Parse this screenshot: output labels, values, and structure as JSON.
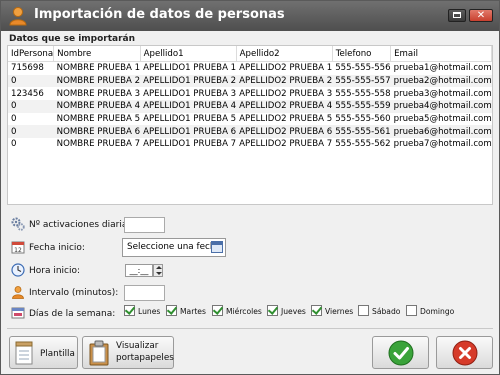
{
  "window": {
    "title": "Importación de datos de personas",
    "close_glyph": "✕"
  },
  "section_title": "Datos que se importarán",
  "grid": {
    "columns": [
      "IdPersona",
      "Nombre",
      "Apellido1",
      "Apellido2",
      "Telefono",
      "Email"
    ],
    "rows": [
      [
        "715698",
        "NOMBRE PRUEBA 1",
        "APELLIDO1 PRUEBA 1",
        "APELLIDO2 PRUEBA 1",
        "555-555-556",
        "prueba1@hotmail.com"
      ],
      [
        "0",
        "NOMBRE PRUEBA 2",
        "APELLIDO1 PRUEBA 2",
        "APELLIDO2 PRUEBA 2",
        "555-555-557",
        "prueba2@hotmail.com"
      ],
      [
        "123456",
        "NOMBRE PRUEBA 3",
        "APELLIDO1 PRUEBA 3",
        "APELLIDO2 PRUEBA 3",
        "555-555-558",
        "prueba3@hotmail.com"
      ],
      [
        "0",
        "NOMBRE PRUEBA 4",
        "APELLIDO1 PRUEBA 4",
        "APELLIDO2 PRUEBA 4",
        "555-555-559",
        "prueba4@hotmail.com"
      ],
      [
        "0",
        "NOMBRE PRUEBA 5",
        "APELLIDO1 PRUEBA 5",
        "APELLIDO2 PRUEBA 5",
        "555-555-560",
        "prueba5@hotmail.com"
      ],
      [
        "0",
        "NOMBRE PRUEBA 6",
        "APELLIDO1 PRUEBA 6",
        "APELLIDO2 PRUEBA 6",
        "555-555-561",
        "prueba6@hotmail.com"
      ],
      [
        "0",
        "NOMBRE PRUEBA 7",
        "APELLIDO1 PRUEBA 7",
        "APELLIDO2 PRUEBA 7",
        "555-555-562",
        "prueba7@hotmail.com"
      ]
    ]
  },
  "form": {
    "activations_label": "Nº activaciones diarias:",
    "activations_value": "",
    "start_date_label": "Fecha inicio:",
    "start_date_button": "Seleccione una fecha",
    "start_time_label": "Hora inicio:",
    "start_time_value": "__:__",
    "interval_label": "Intervalo (minutos):",
    "interval_value": "",
    "weekdays_label": "Días de la semana:",
    "weekdays": [
      {
        "label": "Lunes",
        "checked": true
      },
      {
        "label": "Martes",
        "checked": true
      },
      {
        "label": "Miércoles",
        "checked": true
      },
      {
        "label": "Jueves",
        "checked": true
      },
      {
        "label": "Viernes",
        "checked": true
      },
      {
        "label": "Sábado",
        "checked": false
      },
      {
        "label": "Domingo",
        "checked": false
      }
    ]
  },
  "buttons": {
    "template": "Plantilla",
    "preview_line1": "Visualizar",
    "preview_line2": "portapapeles"
  },
  "colors": {
    "titlebar": "#5c5c5c",
    "accept": "#3aa33a",
    "cancel": "#d63b2a"
  }
}
